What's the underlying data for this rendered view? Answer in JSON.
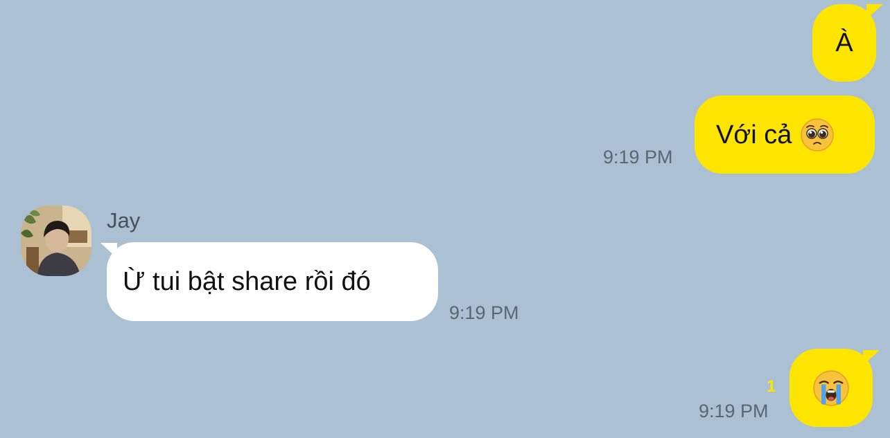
{
  "chat": {
    "messages": [
      {
        "from": "me",
        "text": "À"
      },
      {
        "from": "me",
        "text": "Với cả",
        "emoji": "pleading-face-emoji",
        "time": "9:19 PM"
      },
      {
        "from": "Jay",
        "sender": "Jay",
        "text": "Ừ tui bật share rồi đó",
        "time": "9:19 PM",
        "avatar": "avatar-photo"
      },
      {
        "from": "me",
        "emoji": "loudly-crying-face-emoji",
        "unread": "1",
        "time": "9:19 PM"
      }
    ]
  },
  "colors": {
    "background": "#abc1d3",
    "my_bubble": "#fee500",
    "their_bubble": "#ffffff",
    "time_text": "#5b6670",
    "unread_count": "#fee500"
  }
}
